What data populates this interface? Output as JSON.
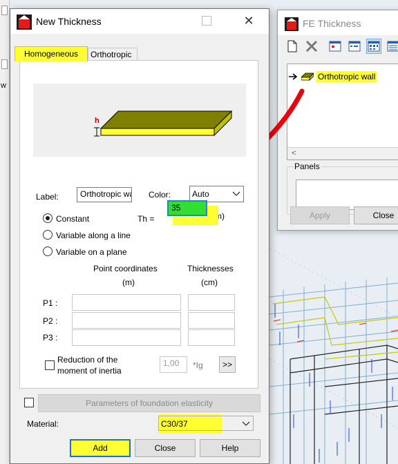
{
  "new_thickness_dialog": {
    "title": "New Thickness",
    "close_glyph": "✕",
    "tabs": [
      {
        "label": "Homogeneous",
        "selected": true
      },
      {
        "label": "Orthotropic",
        "selected": false
      }
    ],
    "preview_h_label": "h",
    "label_caption": "Label:",
    "label_value": "Orthotropic wall",
    "color_caption": "Color:",
    "color_value": "Auto",
    "th_caption": "Th =",
    "th_value": "35",
    "th_unit": "(cm)",
    "thickness_modes": [
      {
        "label": "Constant",
        "selected": true
      },
      {
        "label": "Variable along a line",
        "selected": false
      },
      {
        "label": "Variable on a plane",
        "selected": false
      }
    ],
    "point_coords_header": "Point coordinates",
    "point_coords_unit": "(m)",
    "thicknesses_header": "Thicknesses",
    "thicknesses_unit": "(cm)",
    "points": [
      {
        "label": "P1 :"
      },
      {
        "label": "P2 :"
      },
      {
        "label": "P3 :"
      }
    ],
    "reduction_label_line1": "Reduction of the",
    "reduction_label_line2": "moment of inertia",
    "reduction_value": "1,00",
    "reduction_unit": "*Ig",
    "more_button": ">>",
    "elasticity_button": "Parameters of foundation elasticity",
    "material_caption": "Material:",
    "material_value": "C30/37",
    "buttons": {
      "add": "Add",
      "close": "Close",
      "help": "Help"
    }
  },
  "fe_thickness_window": {
    "title": "FE Thickness",
    "list_items": [
      {
        "label": "Orthotropic wall",
        "selected": true
      }
    ],
    "panels_label": "Panels",
    "apply_button": "Apply",
    "close_button": "Close",
    "scroll_left_glyph": "<"
  },
  "left_strip_text": "w",
  "colors": {
    "highlight_yellow": "#ffff33",
    "th_field_green": "#33dd33",
    "annotation_red": "#e8000b",
    "slab_top": "#7f7f00",
    "slab_side": "#ffff33"
  },
  "icons": [
    "app-icon",
    "new-icon",
    "delete-icon",
    "view-icon-1",
    "view-icon-2",
    "view-icon-3",
    "view-icon-4",
    "chevron-down-icon",
    "arrow-right-icon",
    "wall-icon"
  ]
}
